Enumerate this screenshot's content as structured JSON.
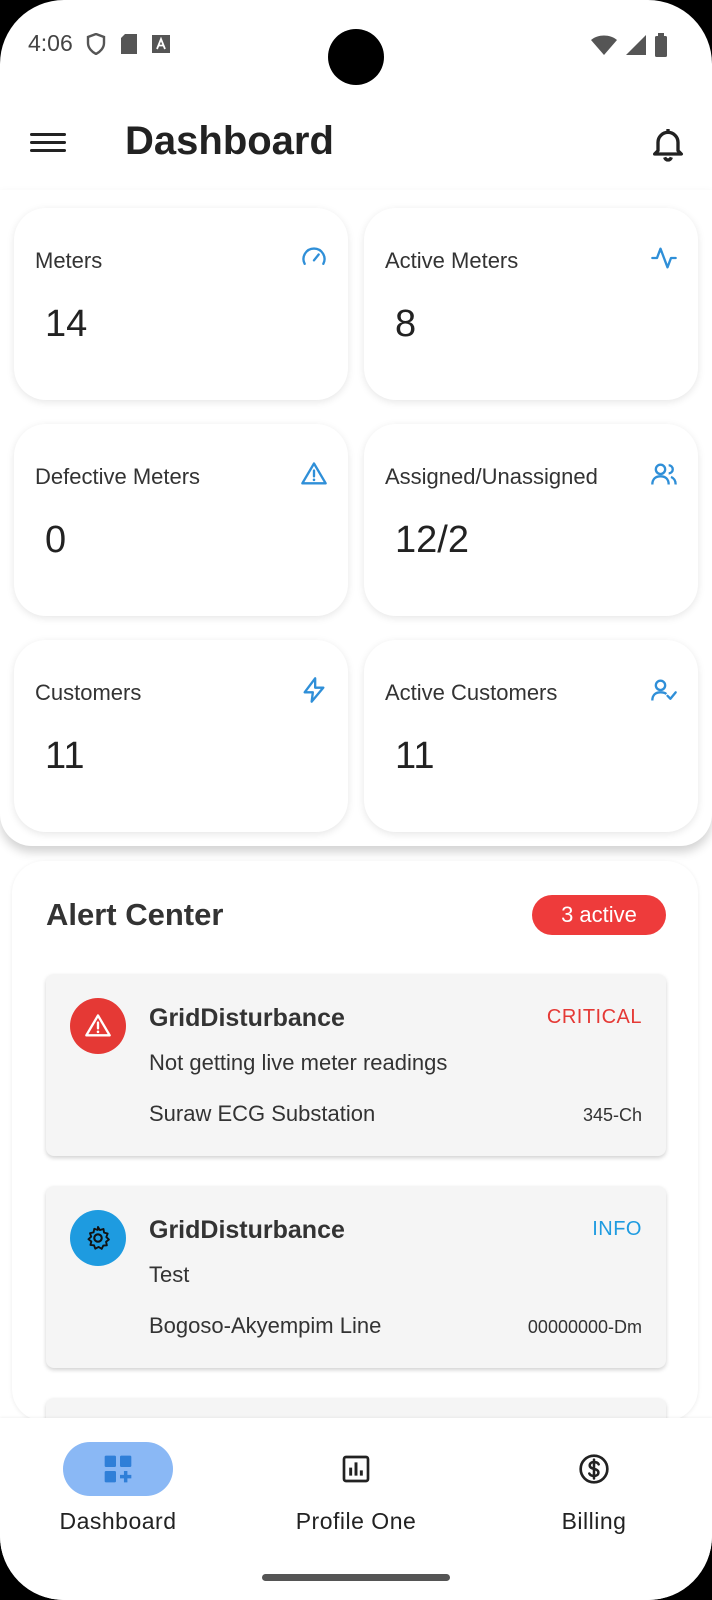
{
  "status_bar": {
    "time": "4:06"
  },
  "app_bar": {
    "title": "Dashboard"
  },
  "stats": [
    {
      "label": "Meters",
      "value": "14",
      "icon": "speedometer-icon"
    },
    {
      "label": "Active Meters",
      "value": "8",
      "icon": "activity-icon"
    },
    {
      "label": "Defective Meters",
      "value": "0",
      "icon": "warning-triangle-icon"
    },
    {
      "label": "Assigned/Unassigned",
      "value": "12/2",
      "icon": "users-icon"
    },
    {
      "label": "Customers",
      "value": "11",
      "icon": "lightning-icon"
    },
    {
      "label": "Active Customers",
      "value": "11",
      "icon": "user-check-icon"
    }
  ],
  "alert_center": {
    "title": "Alert Center",
    "badge": "3 active",
    "alerts": [
      {
        "title": "GridDisturbance",
        "severity": "CRITICAL",
        "message": "Not getting live meter readings",
        "location": "Suraw ECG Substation",
        "code": "345-Ch",
        "icon": "warning-icon"
      },
      {
        "title": "GridDisturbance",
        "severity": "INFO",
        "message": "Test",
        "location": "Bogoso-Akyempim Line",
        "code": "00000000-Dm",
        "icon": "gear-icon"
      }
    ]
  },
  "bottom_nav": {
    "items": [
      {
        "label": "Dashboard",
        "icon": "dashboard-add-icon"
      },
      {
        "label": "Profile One",
        "icon": "bar-chart-icon"
      },
      {
        "label": "Billing",
        "icon": "dollar-circle-icon"
      }
    ]
  },
  "colors": {
    "accent_blue": "#2f8fd8",
    "critical_red": "#e53935",
    "info_blue": "#1e9be0",
    "badge_red": "#ee3b3b",
    "nav_pill": "#8ab8f5"
  }
}
